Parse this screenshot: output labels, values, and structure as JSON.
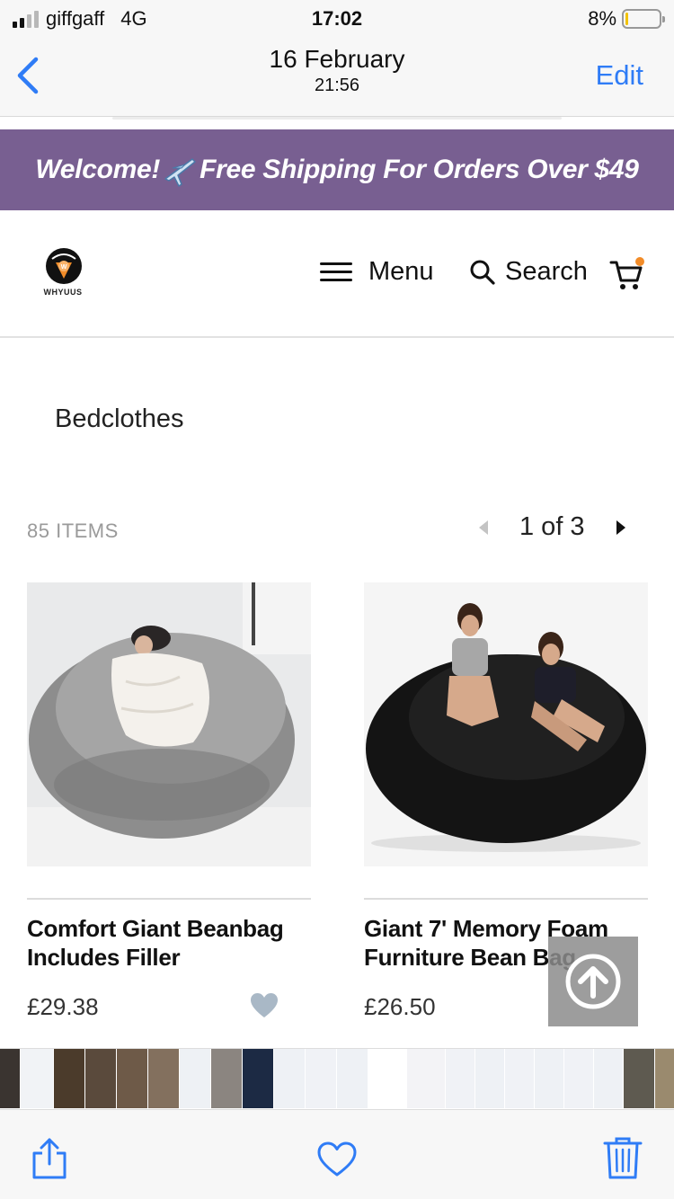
{
  "status": {
    "carrier": "giffgaff",
    "network": "4G",
    "time": "17:02",
    "battery": "8%",
    "battery_level": 0.08
  },
  "nav": {
    "date": "16 February",
    "time": "21:56",
    "edit_label": "Edit"
  },
  "banner": {
    "text_before": "Welcome!",
    "text_after": "Free Shipping For Orders Over $49",
    "background": "#785f91"
  },
  "header": {
    "logo_text": "WHYUUS",
    "menu_label": "Menu",
    "search_label": "Search",
    "cart_badge_color": "#f28c28"
  },
  "listing": {
    "category": "Bedclothes",
    "item_count": "85 ITEMS",
    "pager_label": "1 of 3"
  },
  "products": [
    {
      "title_line1": "Comfort Giant Beanbag",
      "title_line2": "Includes Filler",
      "price": "£29.38"
    },
    {
      "title_line1": "Giant 7' Memory Foam",
      "title_line2": "Furniture Bean Bag",
      "price": "£26.50"
    }
  ],
  "colors": {
    "ios_blue": "#2f7cf6",
    "heart_fav": "#a9b8c6"
  },
  "icons": [
    "back-chevron-icon",
    "airplane-icon",
    "hamburger-icon",
    "search-icon",
    "cart-icon",
    "heart-icon",
    "arrow-up-icon",
    "share-icon",
    "favorite-heart-icon",
    "trash-icon"
  ]
}
